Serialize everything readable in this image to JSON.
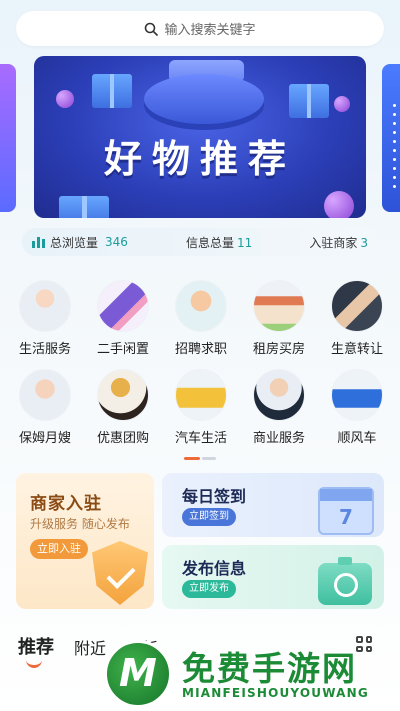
{
  "search": {
    "placeholder": "输入搜索关键字"
  },
  "banner": {
    "title": "好物推荐"
  },
  "stats": [
    {
      "label": "总浏览量",
      "value": "346"
    },
    {
      "label": "信息总量",
      "value": "11"
    },
    {
      "label": "入驻商家",
      "value": "3"
    }
  ],
  "categories": [
    {
      "label": "生活服务",
      "icon": "nurse-avatar-icon"
    },
    {
      "label": "二手闲置",
      "icon": "smartphone-icon"
    },
    {
      "label": "招聘求职",
      "icon": "join-us-icon"
    },
    {
      "label": "租房买房",
      "icon": "house-icon"
    },
    {
      "label": "生意转让",
      "icon": "handshake-icon"
    },
    {
      "label": "保姆月嫂",
      "icon": "nanny-avatar-icon"
    },
    {
      "label": "优惠团购",
      "icon": "wine-food-icon"
    },
    {
      "label": "汽车生活",
      "icon": "yellow-car-icon"
    },
    {
      "label": "商业服务",
      "icon": "businessman-icon"
    },
    {
      "label": "顺风车",
      "icon": "blue-car-icon"
    }
  ],
  "cards": {
    "merchant": {
      "title": "商家入驻",
      "subtitle": "升级服务 随心发布",
      "button": "立即入驻"
    },
    "checkin": {
      "title": "每日签到",
      "button": "立即签到",
      "calendar_day": "7"
    },
    "publish": {
      "title": "发布信息",
      "button": "立即发布"
    }
  },
  "tabs": [
    {
      "label": "推荐",
      "active": true
    },
    {
      "label": "附近",
      "active": false
    },
    {
      "label": "最新",
      "active": false
    }
  ],
  "watermark": {
    "logo_letter": "M",
    "title": "免费手游网",
    "subtitle": "MIANFEISHOUYOUWANG"
  },
  "colors": {
    "accent": "#ee6a3b",
    "teal": "#1a9c9c",
    "banner": "#2c3fb8"
  }
}
